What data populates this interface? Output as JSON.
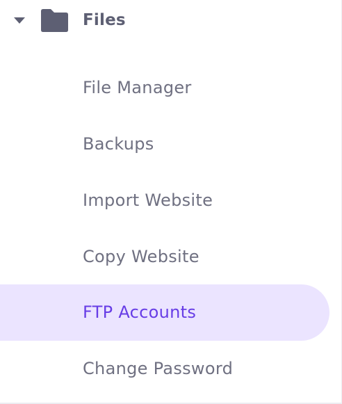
{
  "section": {
    "title": "Files",
    "expanded": true,
    "icon": "folder-icon",
    "toggle_icon": "caret-down-icon"
  },
  "menu": {
    "items": [
      {
        "label": "File Manager",
        "active": false
      },
      {
        "label": "Backups",
        "active": false
      },
      {
        "label": "Import Website",
        "active": false
      },
      {
        "label": "Copy Website",
        "active": false
      },
      {
        "label": "FTP Accounts",
        "active": true
      },
      {
        "label": "Change Password",
        "active": false
      }
    ]
  },
  "colors": {
    "text": "#6f7081",
    "header_text": "#5d5f73",
    "active_text": "#673de6",
    "active_background": "#ebe4ff"
  }
}
